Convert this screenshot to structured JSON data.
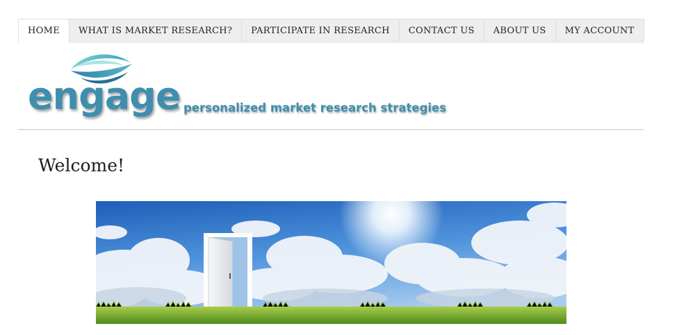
{
  "nav": {
    "tabs": [
      {
        "label": "HOME",
        "active": true
      },
      {
        "label": "WHAT IS MARKET RESEARCH?",
        "active": false
      },
      {
        "label": "PARTICIPATE IN RESEARCH",
        "active": false
      },
      {
        "label": "CONTACT US",
        "active": false
      },
      {
        "label": "ABOUT US",
        "active": false
      },
      {
        "label": "MY ACCOUNT",
        "active": false
      }
    ]
  },
  "header": {
    "logo_text": "engage",
    "tagline": "personalized market research strategies",
    "logo_color": "#3f8eae",
    "logo_icon": "eye-swoosh-icon"
  },
  "main": {
    "heading": "Welcome!",
    "banner_image": "open-door-in-sky-image"
  }
}
